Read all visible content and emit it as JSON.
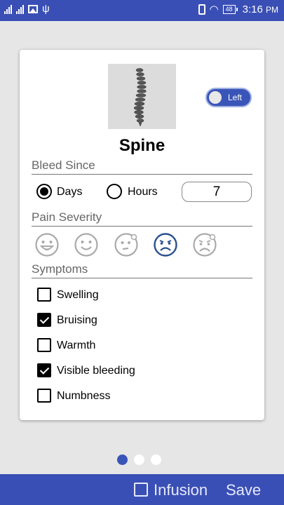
{
  "status_bar": {
    "time": "3:16",
    "time_suffix": "PM",
    "battery": "48"
  },
  "card": {
    "location_title": "Spine",
    "side_toggle": {
      "label": "Left",
      "on": true
    },
    "bleed_since": {
      "label": "Bleed Since",
      "options": [
        {
          "label": "Days",
          "selected": true
        },
        {
          "label": "Hours",
          "selected": false
        }
      ],
      "value": "7"
    },
    "pain_severity": {
      "label": "Pain Severity",
      "levels": [
        "very-happy-face-icon",
        "happy-face-icon",
        "neutral-face-icon",
        "sad-face-icon",
        "crying-face-icon"
      ],
      "selected_index": 3
    },
    "symptoms": {
      "label": "Symptoms",
      "items": [
        {
          "label": "Swelling",
          "checked": false
        },
        {
          "label": "Bruising",
          "checked": true
        },
        {
          "label": "Warmth",
          "checked": false
        },
        {
          "label": "Visible bleeding",
          "checked": true
        },
        {
          "label": "Numbness",
          "checked": false
        }
      ]
    }
  },
  "pager": {
    "pages": 3,
    "current": 1
  },
  "bottom_bar": {
    "infusion_label": "Infusion",
    "infusion_checked": false,
    "save_label": "Save"
  },
  "colors": {
    "primary": "#3a4fb5",
    "accent": "#3a55b8",
    "selected_face": "#2a4f8f",
    "unselected_face": "#aaaaaa"
  }
}
